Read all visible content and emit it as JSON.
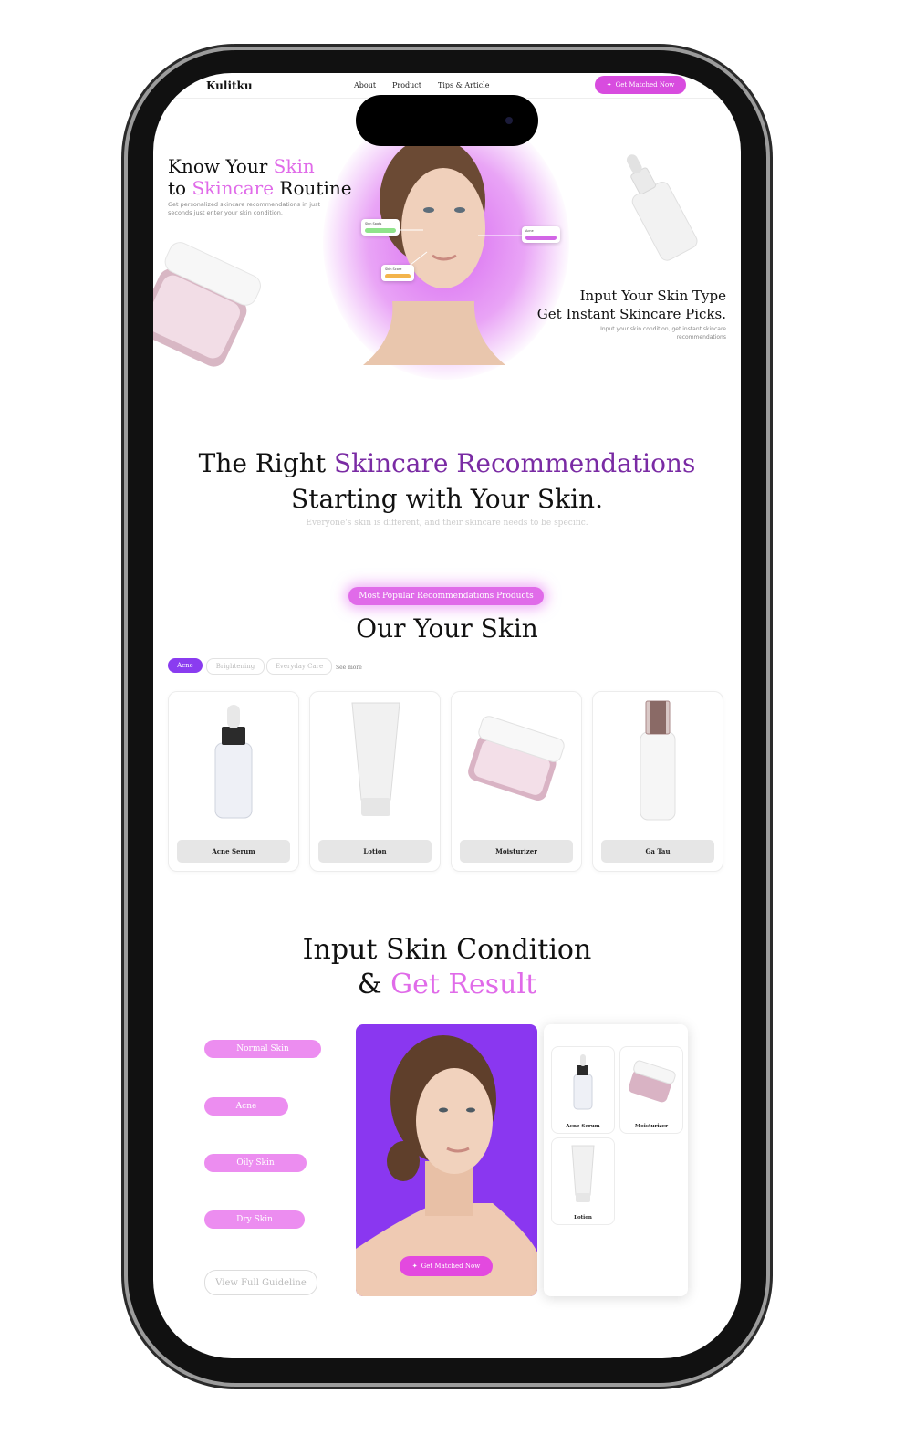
{
  "nav": {
    "logo": "Kulitku",
    "links": [
      "About",
      "Product",
      "Tips & Article"
    ],
    "cta": "Get Matched Now"
  },
  "hero": {
    "title_l1_a": "Know Your ",
    "title_l1_b": "Skin",
    "title_l2_a": "to ",
    "title_l2_b": "Skincare",
    "title_l2_c": " Routine",
    "subtitle": "Get personalized skincare recommendations in just seconds just enter your skin condition.",
    "right_title_l1": "Input Your Skin Type",
    "right_title_l2": "Get Instant Skincare Picks.",
    "right_sub": "Input your skin condition, get instant skincare recommendations"
  },
  "recommend": {
    "line1_a": "The Right ",
    "line1_b": "Skincare Recommendations",
    "line2": "Starting with Your Skin.",
    "subtitle": "Everyone's skin is different, and their skincare needs to be specific."
  },
  "popular": {
    "badge": "Most Popular Recommendations Products",
    "title": "Our Your Skin",
    "filters": [
      "Acne",
      "Brightening",
      "Everyday Care"
    ],
    "see_more": "See more",
    "products": [
      "Acne Serum",
      "Lotion",
      "Moisturizer",
      "Ga Tau"
    ]
  },
  "input": {
    "title_l1": "Input Skin Condition",
    "title_l2_a": "& ",
    "title_l2_b": "Get Result",
    "conditions": [
      "Normal Skin",
      "Acne",
      "Oily Skin",
      "Dry Skin"
    ],
    "guideline": "View Full Guideline",
    "cta": "Get Matched Now",
    "results": [
      "Acne Serum",
      "Moisturizer",
      "Lotion"
    ]
  }
}
